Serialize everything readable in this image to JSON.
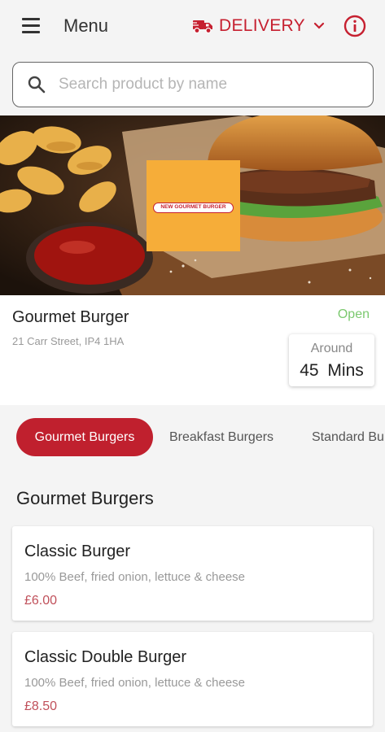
{
  "header": {
    "menu_label": "Menu",
    "order_mode": "DELIVERY",
    "icons": {
      "menu": "hamburger-icon",
      "delivery": "truck-icon",
      "dropdown": "chevron-down-icon",
      "info": "info-icon"
    }
  },
  "search": {
    "placeholder": "Search product by name",
    "icon": "search-icon"
  },
  "banner": {
    "logo_text": "NEW GOURMET BURGER",
    "logo_color": "#f6ad39"
  },
  "store": {
    "name": "Gourmet Burger",
    "address": "21 Carr Street, IP4 1HA",
    "status": "Open",
    "eta_label": "Around",
    "eta_value": "45 Mins"
  },
  "categories": [
    {
      "label": "Gourmet Burgers",
      "active": true
    },
    {
      "label": "Breakfast Burgers",
      "active": false
    },
    {
      "label": "Standard Burgers",
      "active": false
    }
  ],
  "section": {
    "title": "Gourmet Burgers"
  },
  "products": [
    {
      "name": "Classic Burger",
      "description": "100% Beef, fried onion, lettuce & cheese",
      "price": "£6.00"
    },
    {
      "name": "Classic Double Burger",
      "description": "100% Beef, fried onion, lettuce & cheese",
      "price": "£8.50"
    }
  ],
  "colors": {
    "accent": "#c0202e",
    "open": "#7bc96f",
    "price": "#c0505a",
    "background": "#f4f4f4"
  }
}
